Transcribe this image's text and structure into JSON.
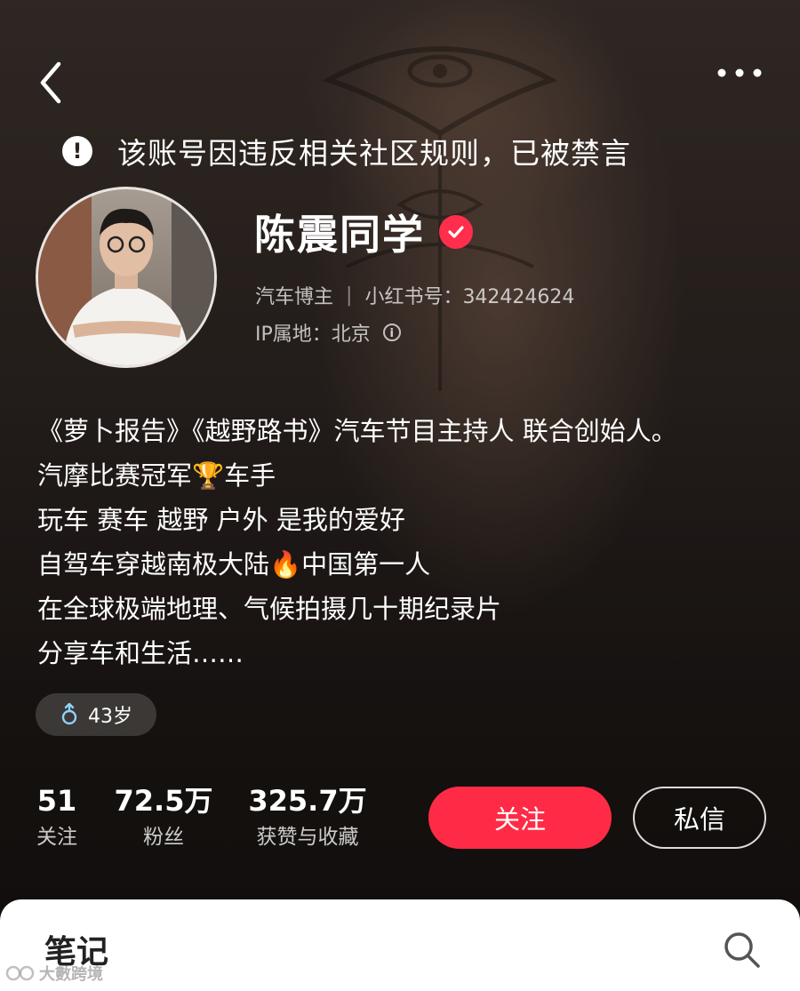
{
  "ban_notice": {
    "icon": "exclamation-circle-icon",
    "text": "该账号因违反相关社区规则，已被禁言"
  },
  "profile": {
    "name": "陈震同学",
    "verified_icon": "verified-check-icon",
    "role": "汽车博主",
    "id_label": "小红书号：342424624",
    "ip_label": "IP属地：北京"
  },
  "bio": [
    "《萝卜报告》《越野路书》汽车节目主持人 联合创始人。",
    "汽摩比赛冠军🏆车手",
    "玩车 赛车 越野 户外 是我的爱好",
    "自驾车穿越南极大陆🔥中国第一人",
    "在全球极端地理、气候拍摄几十期纪录片",
    "分享车和生活……"
  ],
  "tag": {
    "icon": "male-icon",
    "text": "43岁"
  },
  "stats": [
    {
      "value": "51",
      "label": "关注"
    },
    {
      "value": "72.5万",
      "label": "粉丝"
    },
    {
      "value": "325.7万",
      "label": "获赞与收藏"
    }
  ],
  "actions": {
    "follow": "关注",
    "message": "私信"
  },
  "panel": {
    "tab": "笔记"
  },
  "watermark": "大數跨境",
  "colors": {
    "accent": "#ff2b46",
    "verified": "#ff2e4d"
  }
}
